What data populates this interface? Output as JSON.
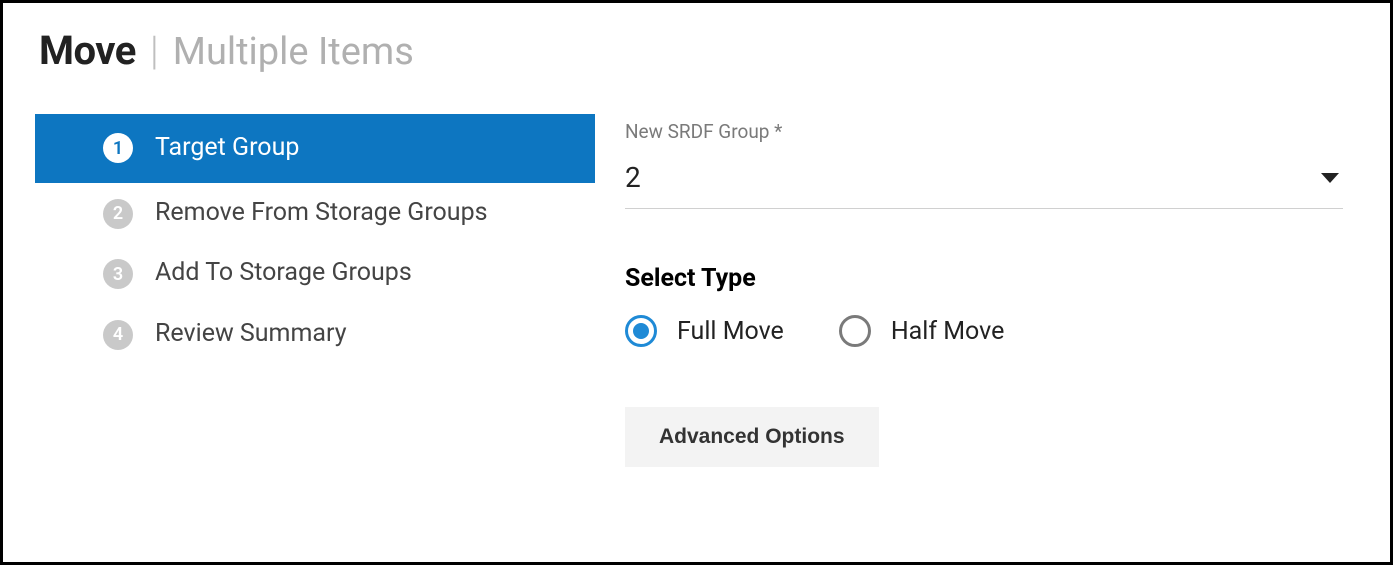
{
  "header": {
    "title": "Move",
    "subtitle": "Multiple Items"
  },
  "steps": [
    {
      "num": "1",
      "label": "Target Group"
    },
    {
      "num": "2",
      "label": "Remove From Storage Groups"
    },
    {
      "num": "3",
      "label": "Add To Storage Groups"
    },
    {
      "num": "4",
      "label": "Review Summary"
    }
  ],
  "form": {
    "group_label": "New SRDF Group *",
    "group_value": "2",
    "select_type_heading": "Select Type",
    "options": {
      "full": "Full Move",
      "half": "Half Move"
    },
    "advanced_button": "Advanced Options"
  }
}
